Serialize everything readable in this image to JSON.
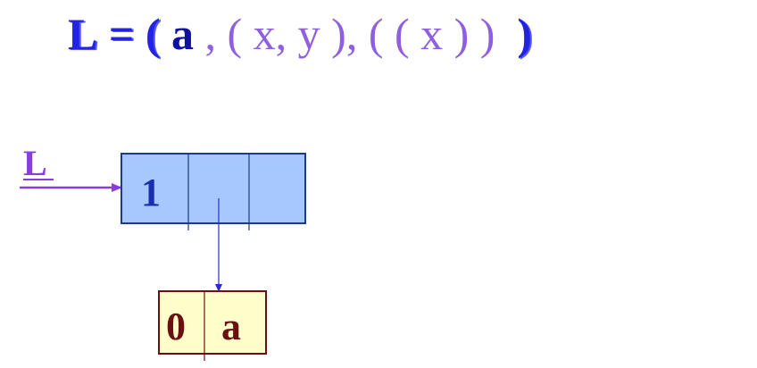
{
  "formula": {
    "lhs": "L",
    "equals": "=",
    "open": "(",
    "atom": "a",
    "rest": ", ( x, y ), ( ( x ) ) ",
    "close": ")"
  },
  "diagram": {
    "pointer_label": "L",
    "list_node": {
      "tag": "1",
      "fill": "#a6c8ff",
      "stroke": "#1a3a8a"
    },
    "atom_node": {
      "tag": "0",
      "value": "a",
      "fill": "#ffffcc",
      "stroke": "#6b1010"
    },
    "colors": {
      "pointer": "#8a3ce0",
      "link": "#2b2bd0",
      "label": "#8a3ce0",
      "list_text": "#1a2fb0",
      "atom_text": "#6b1010"
    }
  }
}
